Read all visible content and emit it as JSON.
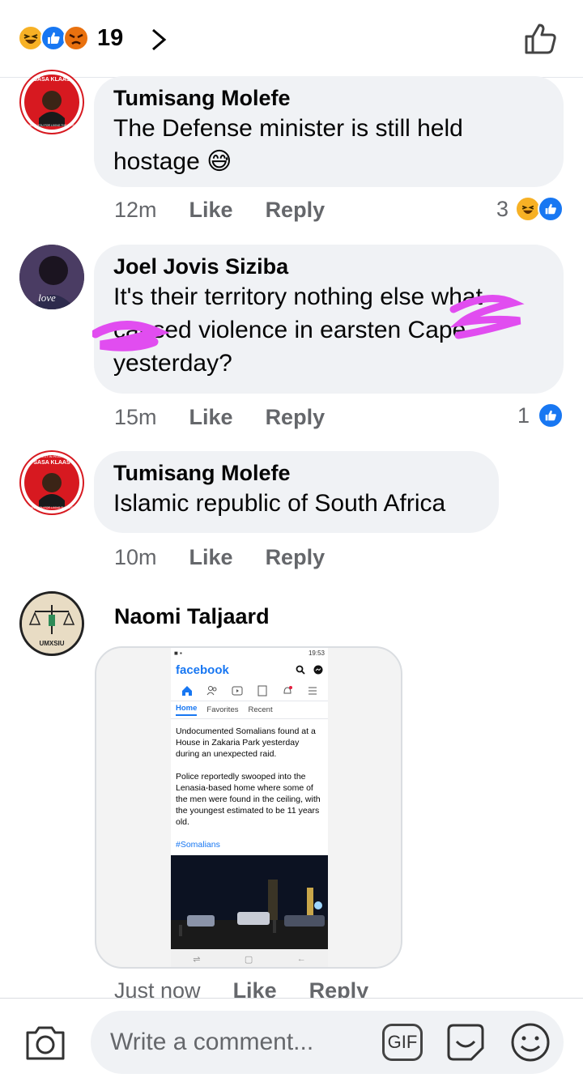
{
  "header": {
    "reaction_count": "19",
    "reaction_icons": [
      "haha-icon",
      "like-icon",
      "angry-icon"
    ],
    "like_icon": "thumbs-up-outline-icon"
  },
  "comments": [
    {
      "author": "Tumisang Molefe",
      "text": "The Defense minister is still held hostage 😅",
      "time": "12m",
      "like_label": "Like",
      "reply_label": "Reply",
      "reaction_count": "3",
      "reactions": [
        "haha",
        "like"
      ],
      "avatar_text": [
        "SASA KLAAS",
        "THANK YOU FOR LIVING THE MUSIC"
      ]
    },
    {
      "author": "Joel Jovis Siziba",
      "text": "It's their territory nothing else what caused violence in earsten Cape yesterday?",
      "time": "15m",
      "like_label": "Like",
      "reply_label": "Reply",
      "reaction_count": "1",
      "reactions": [
        "like"
      ],
      "avatar_text": [
        "love"
      ]
    },
    {
      "author": "Tumisang Molefe",
      "text": "Islamic republic of South Africa",
      "time": "10m",
      "like_label": "Like",
      "reply_label": "Reply",
      "avatar_text": [
        "REST IN PEACE",
        "SASA KLAAS",
        "THANK YOU FOR LIVING THE MUSIC"
      ]
    },
    {
      "author": "Naomi Taljaard",
      "time": "Just now",
      "like_label": "Like",
      "reply_label": "Reply",
      "avatar_text": [
        "UMXSIU"
      ],
      "shared_image": {
        "status_time": "19:53",
        "brand": "facebook",
        "tabs": [
          "Home",
          "Favorites",
          "Recent"
        ],
        "active_tab": "Home",
        "paragraph1": "Undocumented Somalians found at a House in Zakaria Park yesterday during an unexpected raid.",
        "paragraph2": "Police reportedly swooped into the Lenasia-based home where some of the men were found in the ceiling, with the youngest estimated to be 11 years old.",
        "hashtag": "#Somalians"
      }
    }
  ],
  "composer": {
    "placeholder": "Write a comment...",
    "gif_label": "GIF"
  }
}
